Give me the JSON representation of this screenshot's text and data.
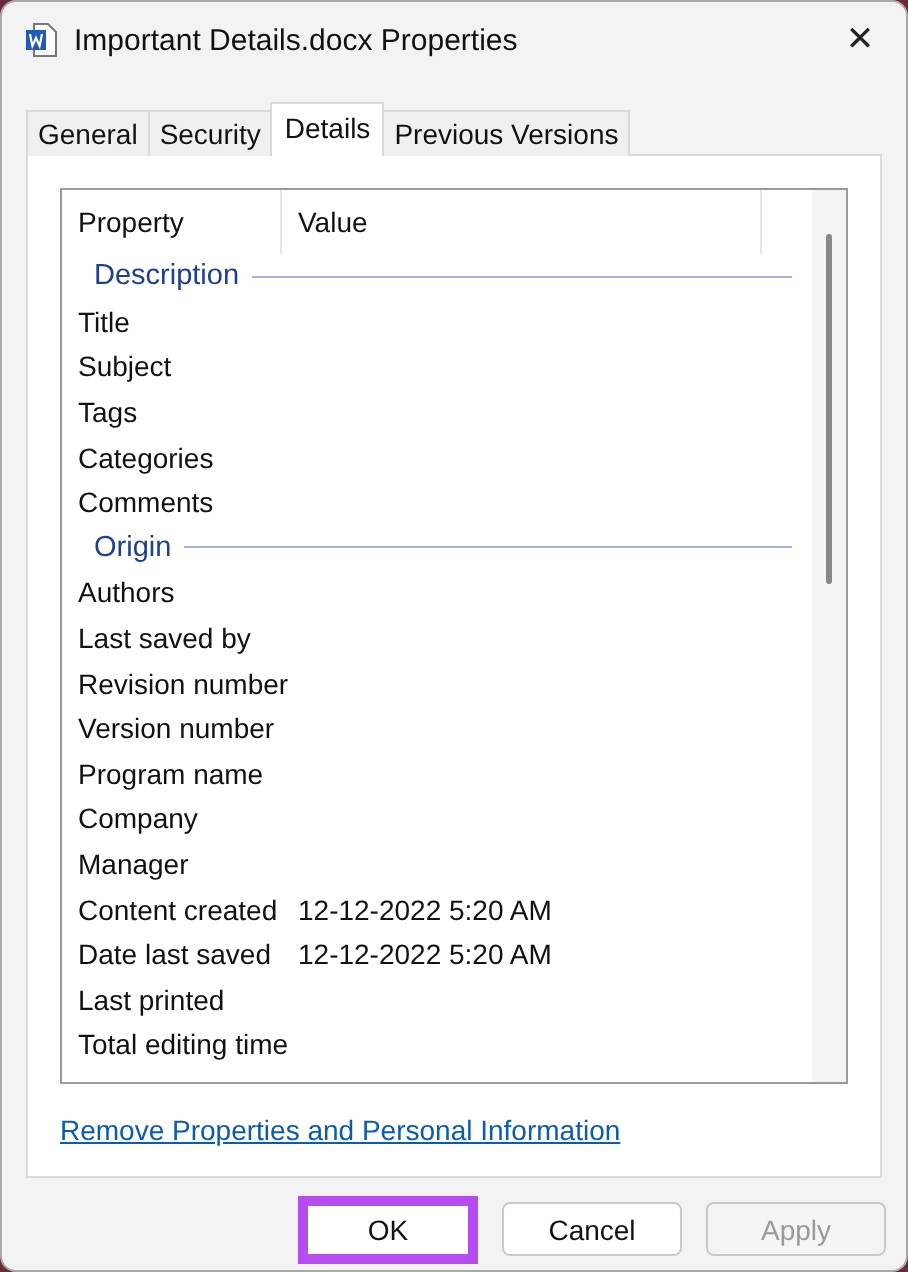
{
  "window": {
    "title": "Important Details.docx Properties",
    "close": "✕"
  },
  "tabs": [
    {
      "label": "General",
      "selected": false
    },
    {
      "label": "Security",
      "selected": false
    },
    {
      "label": "Details",
      "selected": true
    },
    {
      "label": "Previous Versions",
      "selected": false
    }
  ],
  "table": {
    "columns": [
      "Property",
      "Value"
    ],
    "rows": [
      {
        "kind": "group",
        "label": "Description"
      },
      {
        "kind": "item",
        "property": "Title"
      },
      {
        "kind": "item",
        "property": "Subject"
      },
      {
        "kind": "item",
        "property": "Tags"
      },
      {
        "kind": "item",
        "property": "Categories"
      },
      {
        "kind": "item",
        "property": "Comments"
      },
      {
        "kind": "group",
        "label": "Origin"
      },
      {
        "kind": "item",
        "property": "Authors"
      },
      {
        "kind": "item",
        "property": "Last saved by"
      },
      {
        "kind": "item",
        "property": "Revision number"
      },
      {
        "kind": "item",
        "property": "Version number"
      },
      {
        "kind": "item",
        "property": "Program name"
      },
      {
        "kind": "item",
        "property": "Company"
      },
      {
        "kind": "item",
        "property": "Manager"
      },
      {
        "kind": "item",
        "property": "Content created",
        "value": "12-12-2022 5:20 AM"
      },
      {
        "kind": "item",
        "property": "Date last saved",
        "value": "12-12-2022 5:20 AM"
      },
      {
        "kind": "item",
        "property": "Last printed"
      },
      {
        "kind": "item",
        "property": "Total editing time"
      }
    ]
  },
  "link": "Remove Properties and Personal Information",
  "buttons": [
    {
      "label": "OK",
      "disabled": false,
      "highlighted": true
    },
    {
      "label": "Cancel",
      "disabled": false,
      "highlighted": false
    },
    {
      "label": "Apply",
      "disabled": true,
      "highlighted": false
    }
  ]
}
